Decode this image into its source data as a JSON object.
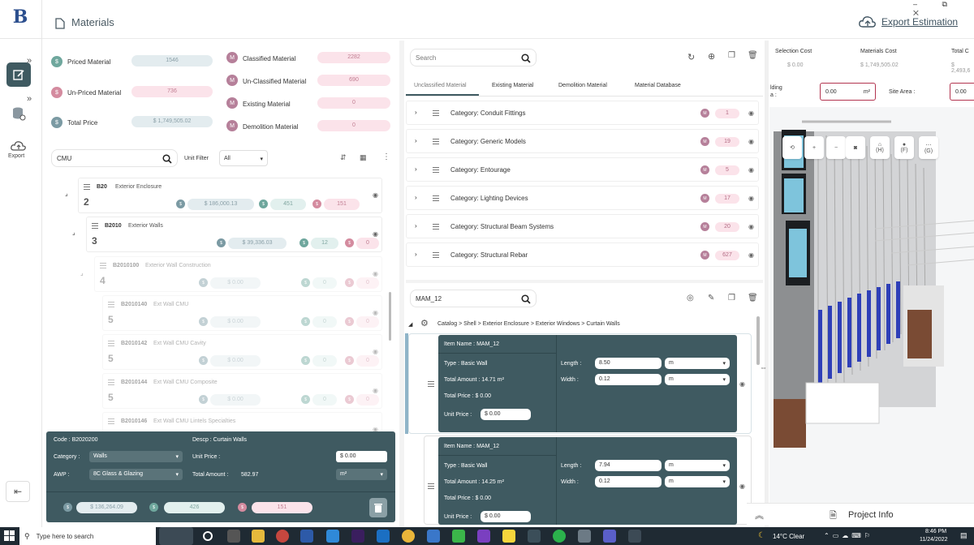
{
  "header": {
    "title": "Materials",
    "export_label": "Export Estimation",
    "window_controls": "–  ⧉  ✕"
  },
  "rail": {
    "export_label": "Export"
  },
  "stats": {
    "priced_label": "Priced Material",
    "priced_value": "1546",
    "unpriced_label": "Un-Priced Material",
    "unpriced_value": "736",
    "total_label": "Total Price",
    "total_value": "$ 1,749,505.02",
    "classified_label": "Classified Material",
    "classified_value": "2282",
    "unclassified_label": "Un-Classified Material",
    "unclassified_value": "690",
    "existing_label": "Existing Material",
    "existing_value": "0",
    "demolition_label": "Demolition Material",
    "demolition_value": "0"
  },
  "left_search": {
    "value": "CMU",
    "unit_filter_label": "Unit Filter",
    "unit_filter_value": "All"
  },
  "tree": [
    {
      "code": "B20",
      "name": "Exterior Enclosure",
      "level": "2",
      "price": "$ 186,000.13",
      "green": "451",
      "red": "151"
    },
    {
      "code": "B2010",
      "name": "Exterior Walls",
      "level": "3",
      "price": "$ 39,336.03",
      "green": "12",
      "red": "0"
    },
    {
      "code": "B2010100",
      "name": "Exterior Wall Construction",
      "level": "4",
      "price": "$ 0.00",
      "green": "0",
      "red": "0"
    },
    {
      "code": "B2010140",
      "name": "Ext Wall CMU",
      "level": "5",
      "price": "$ 0.00",
      "green": "0",
      "red": "0"
    },
    {
      "code": "B2010142",
      "name": "Ext Wall CMU Cavity",
      "level": "5",
      "price": "$ 0.00",
      "green": "0",
      "red": "0"
    },
    {
      "code": "B2010144",
      "name": "Ext Wall CMU Composite",
      "level": "5",
      "price": "$ 0.00",
      "green": "0",
      "red": "0"
    },
    {
      "code": "B2010146",
      "name": "Ext Wall CMU Lintels Specialties",
      "level": "",
      "price": "",
      "green": "",
      "red": ""
    }
  ],
  "detail": {
    "code": "Code : B2020200",
    "descp": "Descp : Curtain Walls",
    "category_label": "Category :",
    "category_value": "Walls",
    "awp_label": "AWP :",
    "awp_value": "8C  Glass & Glazing",
    "unit_price_label": "Unit Price :",
    "unit_price_value": "$ 0.00",
    "total_amount_label": "Total Amount :",
    "total_amount_value": "582.97",
    "unit": "m²",
    "price_pill": "$ 136,264.09",
    "green_pill": "426",
    "red_pill": "151"
  },
  "middle": {
    "search_placeholder": "Search",
    "tabs": [
      "Unclassified Material",
      "Existing Material",
      "Demolition Material",
      "Material Database"
    ],
    "categories": [
      {
        "label": "Category:  Conduit Fittings",
        "count": "1"
      },
      {
        "label": "Category:  Generic Models",
        "count": "19"
      },
      {
        "label": "Category:  Entourage",
        "count": "5"
      },
      {
        "label": "Category:  Lighting Devices",
        "count": "17"
      },
      {
        "label": "Category:  Structural Beam Systems",
        "count": "20"
      },
      {
        "label": "Category:  Structural Rebar",
        "count": "627"
      }
    ],
    "item_search": "MAM_12",
    "breadcrumb": [
      "Catalog",
      "Shell",
      "Exterior Enclosure",
      "Exterior Windows",
      "Curtain Walls"
    ],
    "items": [
      {
        "name": "Item Name : MAM_12",
        "type": "Type :  Basic Wall",
        "total_amount": "Total Amount : 14.71 m²",
        "total_price": "Total Price : $ 0.00",
        "unit_price_label": "Unit Price :",
        "unit_price": "$ 0.00",
        "length_label": "Length :",
        "length": "8.50",
        "width_label": "Width :",
        "width": "0.12",
        "unit": "m"
      },
      {
        "name": "Item Name : MAM_12",
        "type": "Type :  Basic Wall",
        "total_amount": "Total Amount : 14.25 m²",
        "total_price": "Total Price : $ 0.00",
        "unit_price_label": "Unit Price :",
        "unit_price": "$ 0.00",
        "length_label": "Length :",
        "length": "7.94",
        "width_label": "Width :",
        "width": "0.12",
        "unit": "m"
      }
    ]
  },
  "right": {
    "selection_cost_label": "Selection Cost",
    "selection_cost_value": "$ 0.00",
    "materials_cost_label": "Materials Cost",
    "materials_cost_value": "$ 1,749,505.02",
    "total_label": "Total C",
    "total_value": "$ 2,493,6",
    "building_label": "lding\na :",
    "building_value": "0.00",
    "building_unit": "m²",
    "site_area_label": "Site Area :",
    "site_area_value": "0.00",
    "view_buttons": [
      "",
      "",
      "",
      "(H)",
      "(F)",
      "(G)"
    ],
    "project_info": "Project Info"
  },
  "taskbar": {
    "search_placeholder": "Type here to search",
    "weather": "14°C  Clear",
    "time": "8:46 PM",
    "date": "11/24/2022"
  },
  "colors": {
    "dark_panel": "#3f5a61",
    "accent_red": "#b2344f",
    "taskbar": "#1f2a33"
  }
}
